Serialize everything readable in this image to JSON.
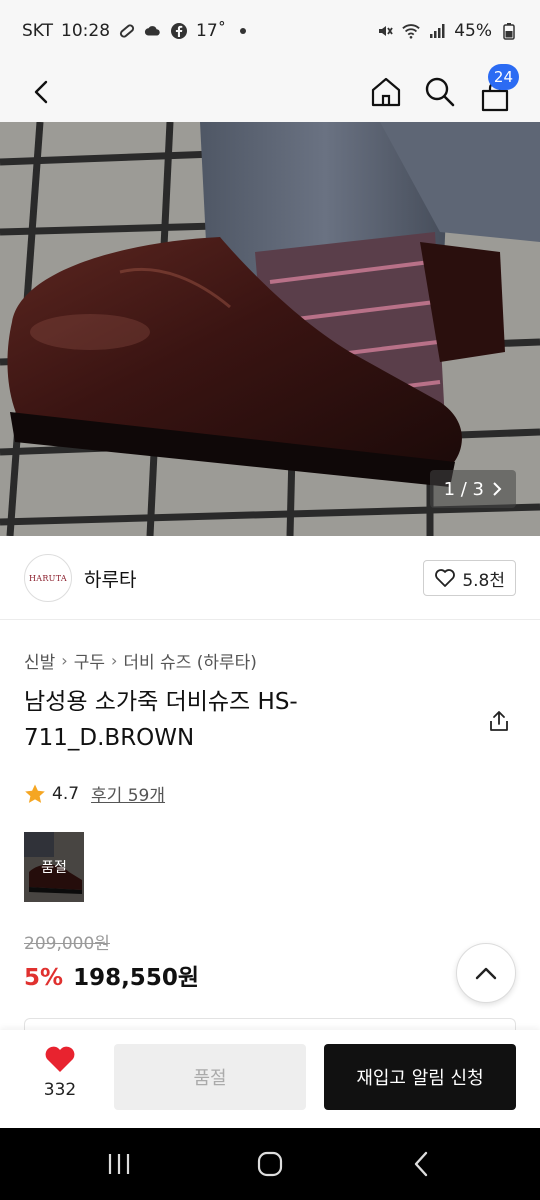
{
  "status_bar": {
    "carrier": "SKT",
    "time": "10:28",
    "temperature": "17˚",
    "battery": "45%",
    "icons": [
      "link-icon",
      "cloud-icon",
      "facebook-icon",
      "dot-icon",
      "mute-icon",
      "wifi-icon",
      "signal-icon",
      "battery-icon"
    ]
  },
  "top_nav": {
    "icons": [
      "back-icon",
      "home-icon",
      "search-icon",
      "cart-icon"
    ],
    "cart_count": "24"
  },
  "hero": {
    "counter": "1 / 3",
    "image_subject": "brown leather derby shoe with patterned socks on tiled floor"
  },
  "brand": {
    "logo_text": "HARUTA",
    "name": "하루타",
    "likes": "5.8천"
  },
  "breadcrumb": [
    "신발",
    "구두",
    "더비 슈즈 (하루타)"
  ],
  "product": {
    "title": "남성용 소가죽 더비슈즈 HS-711_D.BROWN",
    "rating": "4.7",
    "review_link": "후기 59개",
    "option_label": "품절",
    "original_price": "209,000원",
    "discount": "5%",
    "sale_price": "198,550원"
  },
  "action_bar": {
    "wish_count": "332",
    "soldout_label": "품절",
    "restock_label": "재입고 알림 신청"
  },
  "colors": {
    "accent_blue": "#2b6bf3",
    "discount_red": "#e0312f",
    "heart_red": "#e8232f",
    "star_orange": "#f5a623",
    "cta_black": "#111111"
  }
}
